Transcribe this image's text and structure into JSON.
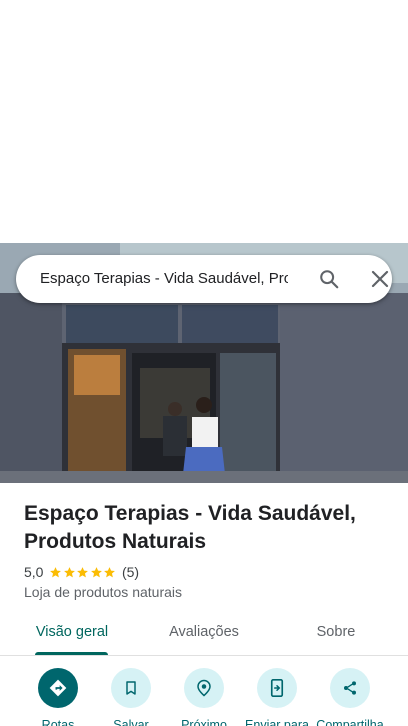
{
  "search": {
    "query": "Espaço Terapias - Vida Saudável, Produtos Naturais"
  },
  "place": {
    "title": "Espaço Terapias - Vida Saudável, Produtos Naturais",
    "rating": "5,0",
    "stars": 5,
    "review_count": "(5)",
    "category": "Loja de produtos naturais"
  },
  "tabs": [
    {
      "label": "Visão geral",
      "active": true
    },
    {
      "label": "Avaliações",
      "active": false
    },
    {
      "label": "Sobre",
      "active": false
    }
  ],
  "actions": [
    {
      "label": "Rotas",
      "icon": "directions-icon"
    },
    {
      "label": "Salvar",
      "icon": "bookmark-icon"
    },
    {
      "label": "Próximo",
      "icon": "nearby-icon"
    },
    {
      "label": "Enviar para",
      "icon": "send-to-phone-icon"
    },
    {
      "label": "Compartilha",
      "icon": "share-icon"
    }
  ],
  "colors": {
    "accent": "#00665e",
    "action_bg": "#d6f2f5",
    "star": "#fbbc04"
  }
}
